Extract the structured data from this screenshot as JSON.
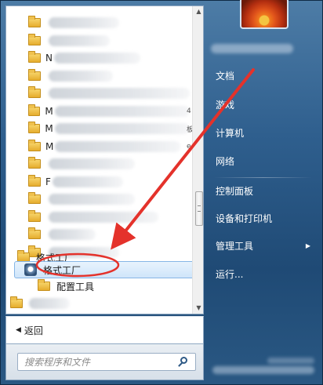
{
  "start_menu": {
    "program_rows": [
      {
        "lead": "",
        "blur_width": 90
      },
      {
        "lead": "",
        "blur_width": 78
      },
      {
        "lead": "N",
        "blur_width": 110
      },
      {
        "lead": "",
        "blur_width": 82
      },
      {
        "lead": "",
        "blur_width": 185
      },
      {
        "lead": "M",
        "blur_width": 180,
        "tail": "4"
      },
      {
        "lead": "M",
        "blur_width": 180,
        "tail": "板"
      },
      {
        "lead": "M",
        "blur_width": 160,
        "tail": "e"
      },
      {
        "lead": "",
        "blur_width": 110
      },
      {
        "lead": "F",
        "blur_width": 90
      },
      {
        "lead": "",
        "blur_width": 110
      },
      {
        "lead": "",
        "blur_width": 140
      },
      {
        "lead": "",
        "blur_width": 60
      },
      {
        "lead": "",
        "blur_width": 90
      }
    ],
    "folder_format_factory": "格式工厂",
    "app_format_factory": "格式工厂",
    "config_tools": "配置工具",
    "last_row_lead": "",
    "back_label": "返回",
    "search_placeholder": "搜索程序和文件",
    "right_items": [
      {
        "label": "文档",
        "has_submenu": false
      },
      {
        "label": "游戏",
        "has_submenu": false
      },
      {
        "label": "计算机",
        "has_submenu": false
      },
      {
        "label": "网络",
        "has_submenu": false
      },
      {
        "label": "控制面板",
        "has_submenu": false
      },
      {
        "label": "设备和打印机",
        "has_submenu": false
      },
      {
        "label": "管理工具",
        "has_submenu": true
      },
      {
        "label": "运行...",
        "has_submenu": false
      }
    ],
    "submenu_glyph": "▶",
    "back_glyph": "◀",
    "scroll_up_glyph": "▲",
    "scroll_down_glyph": "▼",
    "annotation_color": "#e4322b"
  }
}
